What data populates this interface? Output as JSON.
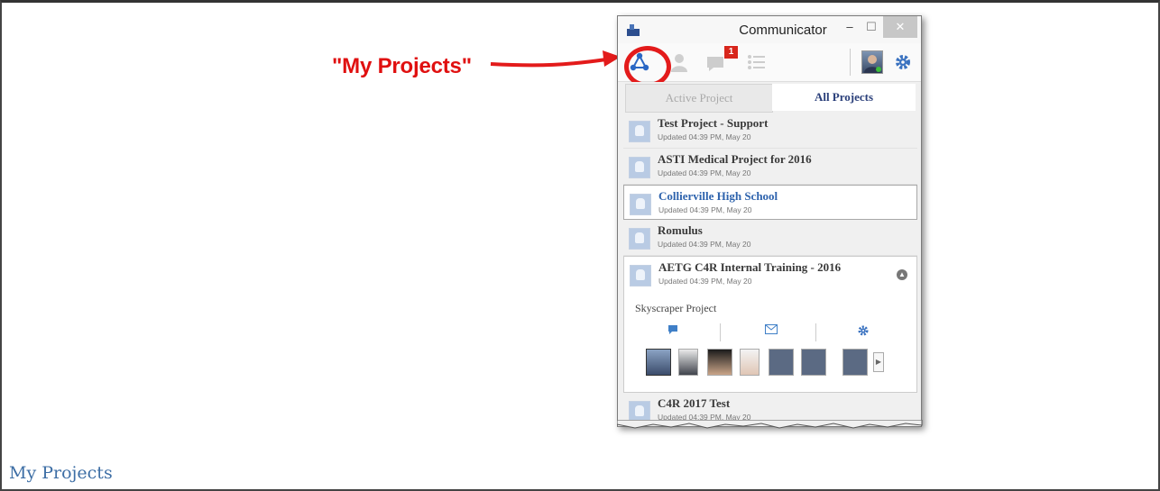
{
  "callout": {
    "label": "\"My Projects\"",
    "color": "#e01010"
  },
  "caption": "My Projects",
  "window": {
    "title": "Communicator",
    "controls": {
      "minimize": "–",
      "maximize": "☐",
      "close": "✕"
    },
    "toolbar": {
      "badge_count": "1"
    },
    "tabs": [
      {
        "label": "Active Project"
      },
      {
        "label": "All Projects"
      }
    ],
    "projects": [
      {
        "name": "Test Project - Support",
        "updated": "Updated 04:39 PM, May 20"
      },
      {
        "name": "ASTI Medical Project for 2016",
        "updated": "Updated 04:39 PM, May 20"
      },
      {
        "name": "Collierville High School",
        "updated": "Updated 04:39 PM, May 20"
      },
      {
        "name": "Romulus",
        "updated": "Updated 04:39 PM, May 20"
      },
      {
        "name": "AETG C4R Internal Training - 2016",
        "updated": "Updated 04:39 PM, May 20",
        "sub": "Skyscraper Project"
      },
      {
        "name": "C4R 2017 Test",
        "updated": "Updated 04:39 PM, May 20"
      }
    ],
    "colors": {
      "accent": "#2e63ad",
      "tab_text": "#2a3f7a",
      "badge": "#d8261c"
    }
  }
}
